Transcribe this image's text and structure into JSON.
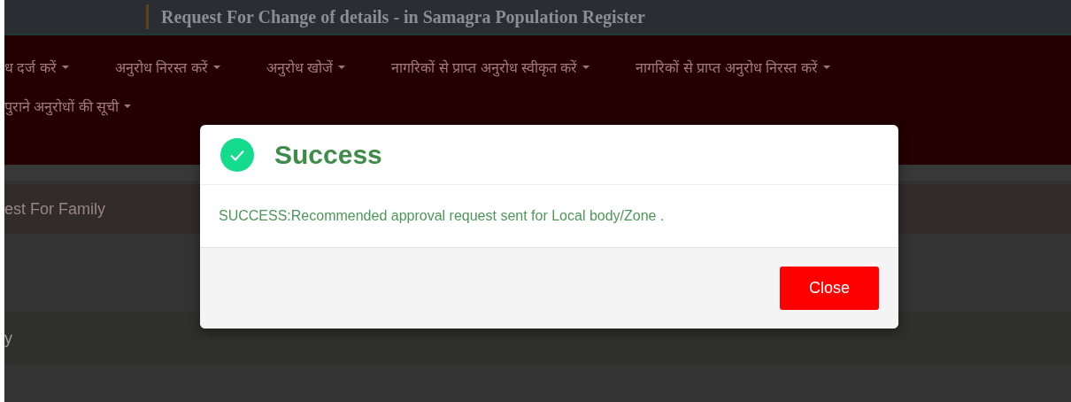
{
  "header": {
    "title": "Request For Change of details - in Samagra Population Register"
  },
  "nav": {
    "items": [
      {
        "label": "ध दर्ज करें",
        "has_dropdown": true
      },
      {
        "label": "अनुरोध निरस्त करें",
        "has_dropdown": true
      },
      {
        "label": "अनुरोध खोजें",
        "has_dropdown": true
      },
      {
        "label": "नागरिकों से प्राप्त अनुरोध स्वीकृत करें",
        "has_dropdown": true
      },
      {
        "label": "नागरिकों से प्राप्त अनुरोध निरस्त करें",
        "has_dropdown": true
      },
      {
        "label": "पुराने अनुरोधों की सूची",
        "has_dropdown": true
      }
    ]
  },
  "content": {
    "rows": [
      {
        "kind": "band",
        "text": ""
      },
      {
        "kind": "panel-heading",
        "text": "est For Family"
      },
      {
        "kind": "blank",
        "text": ""
      },
      {
        "kind": "success-row",
        "text": "y"
      },
      {
        "kind": "blank",
        "text": ""
      }
    ]
  },
  "dialog": {
    "title": "Success",
    "message": "SUCCESS:Recommended approval request sent for Local body/Zone .",
    "button": "Close"
  }
}
